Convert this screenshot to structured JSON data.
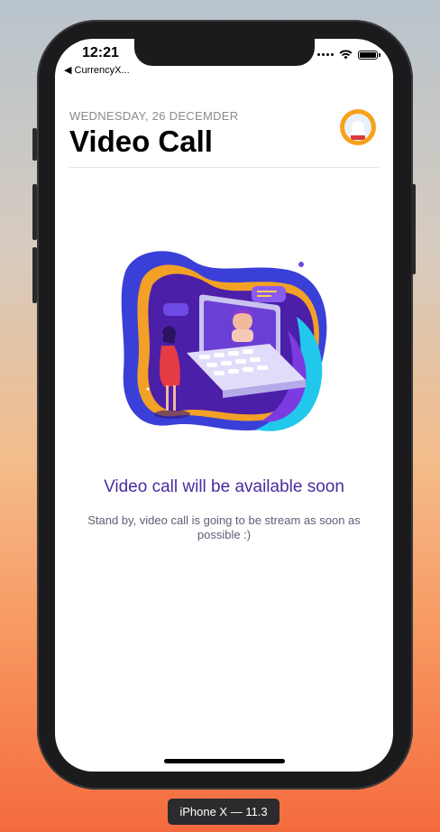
{
  "status_bar": {
    "time": "12:21",
    "back_label": "◀ CurrencyX...",
    "icons": [
      "signal-dots-icon",
      "wifi-icon",
      "battery-icon"
    ]
  },
  "header": {
    "date": "WEDNESDAY, 26 DECEMDER",
    "title": "Video Call",
    "avatar_icon": "profile-avatar-icon"
  },
  "main": {
    "illustration": "video-call-illustration",
    "headline": "Video call will be available soon",
    "subtext": "Stand by, video call is going to be stream as soon as possible :)"
  },
  "device_label": "iPhone X — 11.3",
  "colors": {
    "accent": "#4a2ba0",
    "avatar_bg": "#f6a21a",
    "subtext": "#5c6075"
  }
}
